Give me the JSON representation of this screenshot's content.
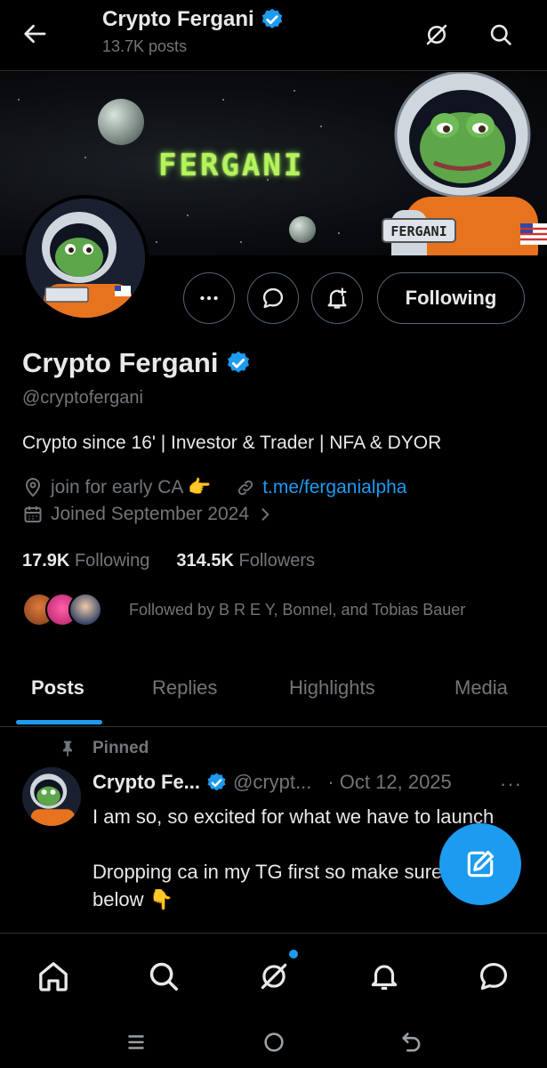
{
  "header": {
    "title": "Crypto Fergani",
    "posts_count": "13.7K posts"
  },
  "banner": {
    "text": "FERGANI",
    "badge_text": "FERGANI"
  },
  "profile": {
    "name": "Crypto Fergani",
    "handle": "@cryptofergani",
    "bio": "Crypto since 16' | Investor & Trader | NFA & DYOR",
    "location": "join for early CA 👉",
    "link": "t.me/ferganialpha",
    "joined": "Joined September 2024",
    "following_count": "17.9K",
    "following_label": "Following",
    "followers_count": "314.5K",
    "followers_label": "Followers",
    "followed_by": "Followed by B R E Y, Bonnel, and Tobias Bauer",
    "follow_button_label": "Following"
  },
  "tabs": [
    {
      "label": "Posts",
      "active": true
    },
    {
      "label": "Replies",
      "active": false
    },
    {
      "label": "Highlights",
      "active": false
    },
    {
      "label": "Media",
      "active": false
    }
  ],
  "post": {
    "pinned_label": "Pinned",
    "author": "Crypto Fe...",
    "handle": "@crypt...",
    "date": "· Oct 12, 2025",
    "more": "···",
    "body": "I am so, so excited for what we have to launch\n\nDropping ca in my TG first so make sure you join below 👇"
  },
  "colors": {
    "accent": "#1d9bf0",
    "background": "#000000",
    "muted": "#71767b",
    "text": "#e7e9ea"
  },
  "icons": {
    "back": "arrow-left-icon",
    "grok": "grok-icon",
    "search": "search-icon",
    "verified": "verified-badge-icon",
    "more": "more-icon",
    "message": "message-icon",
    "notify": "notification-add-icon",
    "location": "location-icon",
    "link": "link-icon",
    "calendar": "calendar-icon",
    "chevron": "chevron-right-icon",
    "pin": "pin-icon",
    "compose": "compose-icon",
    "home": "home-icon",
    "bell": "bell-icon",
    "chat": "chat-icon"
  }
}
